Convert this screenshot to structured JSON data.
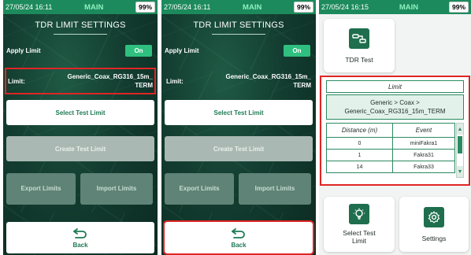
{
  "screens": [
    {
      "status": {
        "time": "27/05/24 16:11",
        "mode": "MAIN",
        "battery": "99%"
      },
      "title": "TDR LIMIT SETTINGS",
      "apply": {
        "label": "Apply Limit",
        "toggle": "On"
      },
      "limit": {
        "label": "Limit:",
        "value": "Generic_Coax_RG316_15m_TERM"
      },
      "buttons": {
        "select": "Select Test Limit",
        "create": "Create Test Limit",
        "export": "Export Limits",
        "import": "Import Limits",
        "back": "Back"
      },
      "highlight": "limit-row"
    },
    {
      "status": {
        "time": "27/05/24 16:11",
        "mode": "MAIN",
        "battery": "99%"
      },
      "title": "TDR LIMIT SETTINGS",
      "apply": {
        "label": "Apply Limit",
        "toggle": "On"
      },
      "limit": {
        "label": "Limit:",
        "value": "Generic_Coax_RG316_15m_TERM"
      },
      "buttons": {
        "select": "Select Test Limit",
        "create": "Create Test Limit",
        "export": "Export Limits",
        "import": "Import Limits",
        "back": "Back"
      },
      "highlight": "back-button"
    },
    {
      "status": {
        "time": "27/05/24 16:15",
        "mode": "MAIN",
        "battery": "99%"
      },
      "tdr_test_label": "TDR Test",
      "limit_header": "Limit",
      "limit_path": "Generic > Coax > Generic_Coax_RG316_15m_TERM",
      "table": {
        "columns": [
          "Distance (m)",
          "Event"
        ],
        "rows": [
          {
            "distance": "0",
            "event": "miniFakra1"
          },
          {
            "distance": "1",
            "event": "Fakra31"
          },
          {
            "distance": "14",
            "event": "Fakra33"
          }
        ]
      },
      "select_tile": "Select Test Limit",
      "settings_tile": "Settings"
    }
  ],
  "colors": {
    "status_bar": "#1c8a5c",
    "accent": "#2fc07f",
    "highlight": "#e02525",
    "brand_dark": "#1f6e4d"
  },
  "icons": [
    "back-arrow-icon",
    "tdr-cable-icon",
    "lightbulb-icon",
    "gear-icon",
    "scroll-up-icon",
    "scroll-down-icon"
  ]
}
